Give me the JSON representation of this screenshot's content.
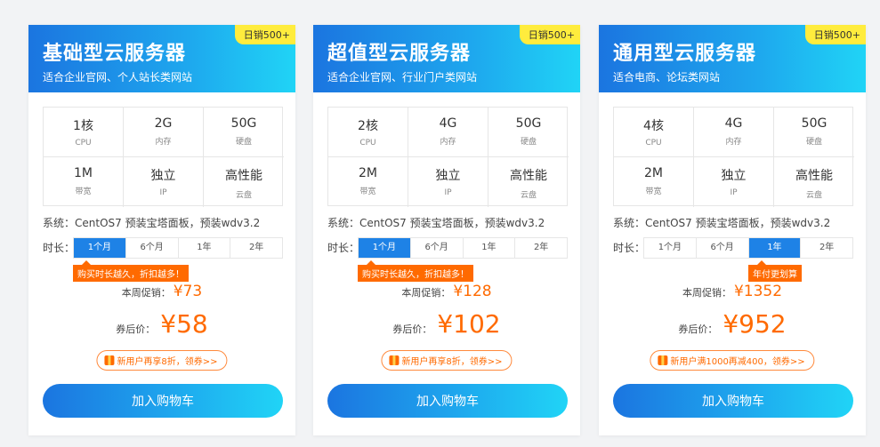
{
  "cards": [
    {
      "title": "基础型云服务器",
      "subtitle": "适合企业官网、个人站长类网站",
      "sales": "日销500+",
      "specs": [
        {
          "value": "1核",
          "label": "CPU"
        },
        {
          "value": "2G",
          "label": "内存"
        },
        {
          "value": "50G",
          "label": "硬盘"
        },
        {
          "value": "1M",
          "label": "带宽"
        },
        {
          "value": "独立",
          "label": "IP"
        },
        {
          "value": "高性能",
          "label": "云盘"
        }
      ],
      "system": "系统：CentOS7 预装宝塔面板，预装wdv3.2",
      "duration_label": "时长：",
      "durations": [
        "1个月",
        "6个月",
        "1年",
        "2年"
      ],
      "active_duration": "1个月",
      "promo_tip": "购买时长越久，折扣越多！",
      "week_price_label": "本周促销：",
      "week_price": "¥73",
      "final_price_label": "券后价：",
      "final_price": "¥58",
      "coupon": "新用户再享8折，领券>>",
      "cart_label": "加入购物车"
    },
    {
      "title": "超值型云服务器",
      "subtitle": "适合企业官网、行业门户类网站",
      "sales": "日销500+",
      "specs": [
        {
          "value": "2核",
          "label": "CPU"
        },
        {
          "value": "4G",
          "label": "内存"
        },
        {
          "value": "50G",
          "label": "硬盘"
        },
        {
          "value": "2M",
          "label": "带宽"
        },
        {
          "value": "独立",
          "label": "IP"
        },
        {
          "value": "高性能",
          "label": "云盘"
        }
      ],
      "system": "系统：CentOS7 预装宝塔面板，预装wdv3.2",
      "duration_label": "时长：",
      "durations": [
        "1个月",
        "6个月",
        "1年",
        "2年"
      ],
      "active_duration": "1个月",
      "promo_tip": "购买时长越久，折扣越多！",
      "week_price_label": "本周促销：",
      "week_price": "¥128",
      "final_price_label": "券后价：",
      "final_price": "¥102",
      "coupon": "新用户再享8折，领券>>",
      "cart_label": "加入购物车"
    },
    {
      "title": "通用型云服务器",
      "subtitle": "适合电商、论坛类网站",
      "sales": "日销500+",
      "specs": [
        {
          "value": "4核",
          "label": "CPU"
        },
        {
          "value": "4G",
          "label": "内存"
        },
        {
          "value": "50G",
          "label": "硬盘"
        },
        {
          "value": "2M",
          "label": "带宽"
        },
        {
          "value": "独立",
          "label": "IP"
        },
        {
          "value": "高性能",
          "label": "云盘"
        }
      ],
      "system": "系统：CentOS7 预装宝塔面板，预装wdv3.2",
      "duration_label": "时长：",
      "durations": [
        "1个月",
        "6个月",
        "1年",
        "2年"
      ],
      "active_duration": "1年",
      "promo_tip": "年付更划算",
      "week_price_label": "本周促销：",
      "week_price": "¥1352",
      "final_price_label": "券后价：",
      "final_price": "¥952",
      "coupon": "新用户满1000再减400，领券>>",
      "cart_label": "加入购物车"
    }
  ],
  "colors": {
    "accent_blue": "#1e82e6",
    "price_orange": "#ff6a00",
    "badge_yellow": "#ffec3d"
  }
}
